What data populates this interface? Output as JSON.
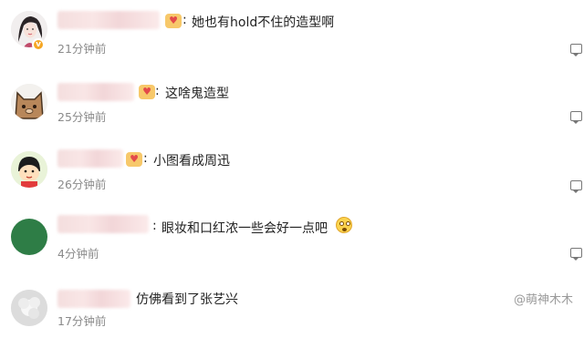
{
  "comments": [
    {
      "text": "她也有hold不住的造型啊",
      "time": "21分钟前"
    },
    {
      "text": "这啥鬼造型",
      "time": "25分钟前"
    },
    {
      "text": "小图看成周迅",
      "time": "26分钟前"
    },
    {
      "text": "眼妆和口红浓一些会好一点吧",
      "time": "4分钟前"
    },
    {
      "text": "仿佛看到了张艺兴",
      "time": "17分钟前"
    }
  ],
  "separator": ":",
  "watermark": "@萌神木木",
  "icons": {
    "verified": "verified-badge-icon",
    "rank": "fan-rank-badge-icon",
    "reply": "reply-comment-icon",
    "emoji": "flushed-face-emoji-icon"
  },
  "colors": {
    "time": "#8a8a8a",
    "text": "#222222",
    "badge": "#f5a623"
  }
}
